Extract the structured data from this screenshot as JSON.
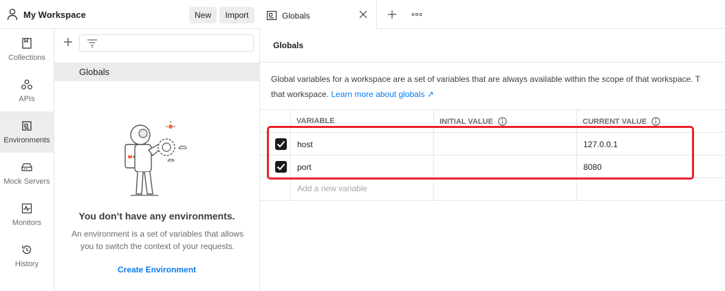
{
  "workspace": {
    "title": "My Workspace",
    "new_label": "New",
    "import_label": "Import"
  },
  "nav": {
    "items": [
      {
        "label": "Collections",
        "icon": "collections-icon",
        "active": false
      },
      {
        "label": "APIs",
        "icon": "apis-icon",
        "active": false
      },
      {
        "label": "Environments",
        "icon": "environments-icon",
        "active": true
      },
      {
        "label": "Mock Servers",
        "icon": "mock-servers-icon",
        "active": false
      },
      {
        "label": "Monitors",
        "icon": "monitors-icon",
        "active": false
      },
      {
        "label": "History",
        "icon": "history-icon",
        "active": false
      }
    ]
  },
  "sidebar": {
    "selected_item": "Globals",
    "empty_title": "You don’t have any environments.",
    "empty_desc": "An environment is a set of variables that allows you to switch the context of your requests.",
    "create_label": "Create Environment"
  },
  "tabs": [
    {
      "label": "Globals",
      "active": true
    }
  ],
  "content": {
    "title": "Globals",
    "desc_line1": "Global variables for a workspace are a set of variables that are always available within the scope of that workspace. T",
    "desc_line2_prefix": "that workspace. ",
    "learn_more": "Learn more about globals ↗"
  },
  "table": {
    "headers": [
      "VARIABLE",
      "INITIAL VALUE",
      "CURRENT VALUE"
    ],
    "rows": [
      {
        "checked": true,
        "variable": "host",
        "initial": "",
        "current": "127.0.0.1"
      },
      {
        "checked": true,
        "variable": "port",
        "initial": "",
        "current": "8080"
      }
    ],
    "add_placeholder": "Add a new variable"
  },
  "colors": {
    "accent": "#097bed",
    "highlight": "#e8232c",
    "active_nav": "#ededed"
  }
}
